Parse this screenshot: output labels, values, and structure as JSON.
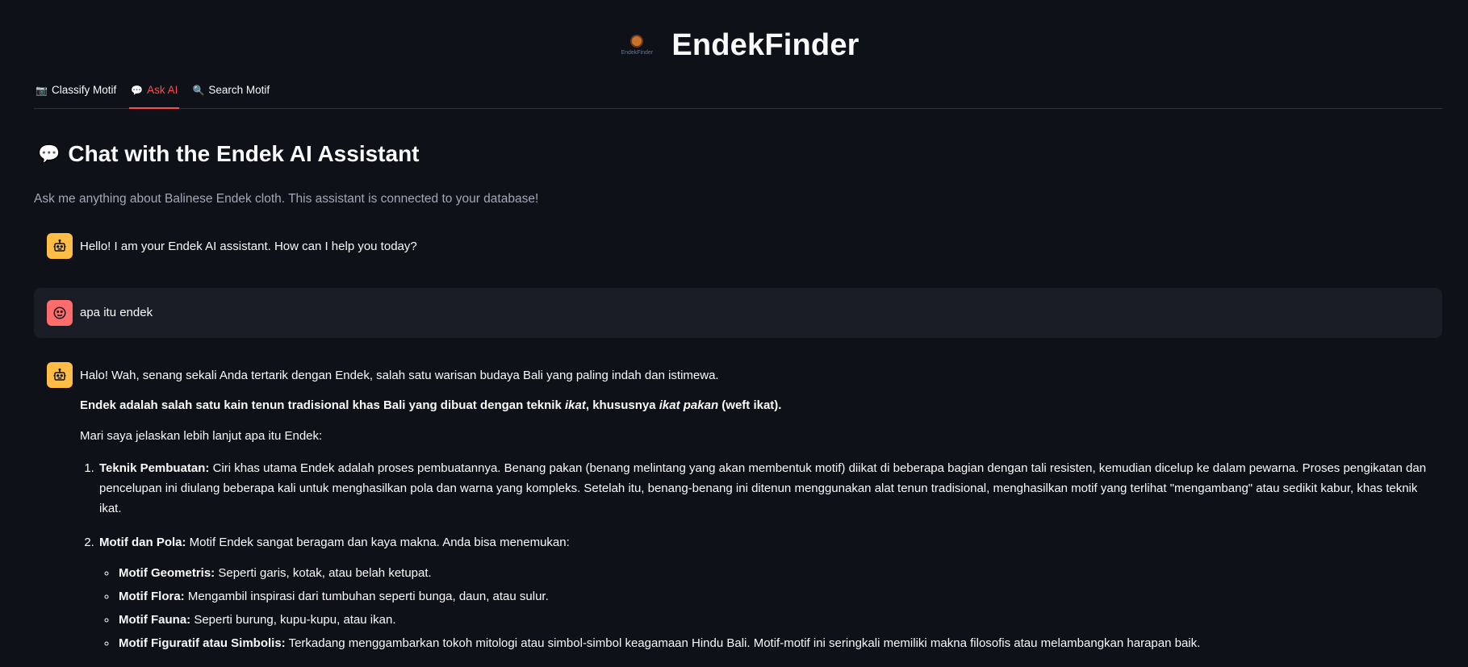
{
  "header": {
    "logo_caption": "EndekFinder",
    "title": "EndekFinder"
  },
  "tabs": [
    {
      "icon": "📷",
      "label": "Classify Motif"
    },
    {
      "icon": "💬",
      "label": "Ask AI"
    },
    {
      "icon": "🔍",
      "label": "Search Motif"
    }
  ],
  "active_tab": "Ask AI",
  "page": {
    "title_icon": "💬",
    "title": "Chat with the Endek AI Assistant",
    "caption": "Ask me anything about Balinese Endek cloth. This assistant is connected to your database!"
  },
  "chat": {
    "greeting": "Hello! I am your Endek AI assistant. How can I help you today?",
    "user_message": "apa itu endek",
    "answer": {
      "intro": "Halo! Wah, senang sekali Anda tertarik dengan Endek, salah satu warisan budaya Bali yang paling indah dan istimewa.",
      "def_a": "Endek adalah salah satu kain tenun tradisional khas Bali yang dibuat dengan teknik ",
      "def_b": "ikat",
      "def_c": ", khususnya ",
      "def_d": "ikat pakan",
      "def_e": " (weft ikat).",
      "lead": "Mari saya jelaskan lebih lanjut apa itu Endek:",
      "item1_title": "Teknik Pembuatan:",
      "item1_text": " Ciri khas utama Endek adalah proses pembuatannya. Benang pakan (benang melintang yang akan membentuk motif) diikat di beberapa bagian dengan tali resisten, kemudian dicelup ke dalam pewarna. Proses pengikatan dan pencelupan ini diulang beberapa kali untuk menghasilkan pola dan warna yang kompleks. Setelah itu, benang-benang ini ditenun menggunakan alat tenun tradisional, menghasilkan motif yang terlihat \"mengambang\" atau sedikit kabur, khas teknik ikat.",
      "item2_title": "Motif dan Pola:",
      "item2_text": " Motif Endek sangat beragam dan kaya makna. Anda bisa menemukan:",
      "sub1_title": "Motif Geometris:",
      "sub1_text": " Seperti garis, kotak, atau belah ketupat.",
      "sub2_title": "Motif Flora:",
      "sub2_text": " Mengambil inspirasi dari tumbuhan seperti bunga, daun, atau sulur.",
      "sub3_title": "Motif Fauna:",
      "sub3_text": " Seperti burung, kupu-kupu, atau ikan.",
      "sub4_title": "Motif Figuratif atau Simbolis:",
      "sub4_text": " Terkadang menggambarkan tokoh mitologi atau simbol-simbol keagamaan Hindu Bali. Motif-motif ini seringkali memiliki makna filosofis atau melambangkan harapan baik."
    }
  },
  "colors": {
    "background": "#0e1117",
    "accent": "#ff4b4b",
    "bot_avatar": "#ffbd45",
    "user_avatar": "#ff6c6c",
    "user_bubble": "#1a1d25"
  }
}
